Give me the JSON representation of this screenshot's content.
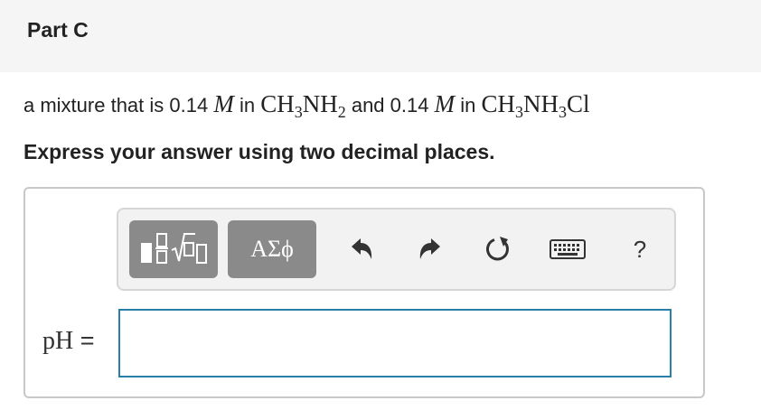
{
  "header": {
    "title": "Part C"
  },
  "problem": {
    "prefix": "a mixture that is ",
    "conc1": "0.14",
    "unit1": "M",
    "in1": " in ",
    "compound1": {
      "a": "CH",
      "a_sub": "3",
      "b": "NH",
      "b_sub": "2"
    },
    "and": " and ",
    "conc2": "0.14",
    "unit2": "M",
    "in2": " in ",
    "compound2": {
      "a": "CH",
      "a_sub": "3",
      "b": "NH",
      "b_sub": "3",
      "c": "Cl"
    }
  },
  "instruction": "Express your answer using two decimal places.",
  "toolbar": {
    "symbols_label": "ΑΣϕ",
    "help_label": "?",
    "icons": [
      "templates-icon",
      "greek-symbols-icon",
      "undo-icon",
      "redo-icon",
      "reset-icon",
      "keyboard-icon",
      "help-icon"
    ]
  },
  "answer": {
    "label_var": "pH",
    "label_eq": " =",
    "value": "",
    "placeholder": ""
  },
  "colors": {
    "header_bg": "#f5f5f5",
    "toolbar_button": "#8a8a8a",
    "input_border": "#2a7fa8"
  }
}
